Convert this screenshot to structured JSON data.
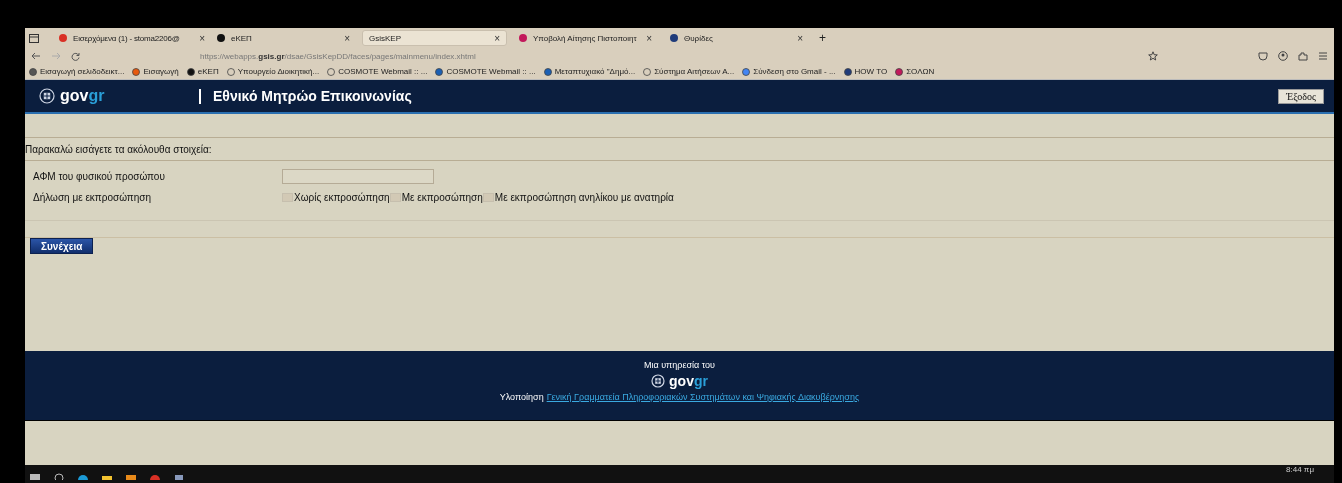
{
  "browser": {
    "tabs": [
      {
        "title": "Εισερχόμενα (1) - stoma2206@",
        "selected": false,
        "close": "×"
      },
      {
        "title": "eΚΕΠ",
        "selected": false,
        "close": "×"
      },
      {
        "title": "GsisKEP",
        "selected": true,
        "close": "×"
      },
      {
        "title": "Υποβολή Αίτησης Πιστοποιητ",
        "selected": false,
        "close": "×"
      },
      {
        "title": "Θυρίδες",
        "selected": false,
        "close": "×"
      }
    ],
    "new_tab": "+",
    "url": "https://webapps.**gsis.gr**/dsae/GsisKepDD/faces/pages/mainmenu/index.xhtml",
    "bookmarks": [
      "Εισαγωγή σελιδοδεικτ...",
      "Εισαγωγή",
      "eΚΕΠ",
      "Υπουργείο Διοικητική...",
      "COSMOTE Webmail :: ...",
      "COSMOTE Webmail :: ...",
      "Μεταπτυχιακό \"Δημό...",
      "Σύστημα Αιτήσεων Α...",
      "Σύνδεση στο Gmail - ...",
      "HOW TO",
      "ΣΟΛΩΝ"
    ]
  },
  "header": {
    "logo": {
      "text": "gov",
      "accent": "gr"
    },
    "title": "Εθνικό Μητρώο Επικοινωνίας",
    "logout": "Έξοδος"
  },
  "form": {
    "instruction": "Παρακαλώ εισάγετε τα ακόλουθα στοιχεία:",
    "fields": [
      {
        "kind": "text",
        "label": "ΑΦΜ του φυσικού προσώπου"
      },
      {
        "kind": "checks",
        "label": "Δήλωση με εκπροσώπηση",
        "options": [
          {
            "label": "Χωρίς εκπροσώπηση",
            "checked": false
          },
          {
            "label": "Με εκπροσώπηση",
            "checked": false
          },
          {
            "label": "Με εκπροσώπηση ανηλίκου με ανατηρία",
            "checked": false
          }
        ]
      }
    ],
    "submit": "Συνέχεια"
  },
  "footer": {
    "service": "Μια υπηρεσία του",
    "logo": {
      "text": "gov",
      "accent": "gr"
    },
    "impl_label": "Υλοποίηση",
    "impl_link": "Γενική Γραμματεία Πληροφοριακών Συστημάτων και Ψηφιακής Διακυβέρνησης"
  },
  "taskbar": {
    "time": "8:44 πμ"
  }
}
